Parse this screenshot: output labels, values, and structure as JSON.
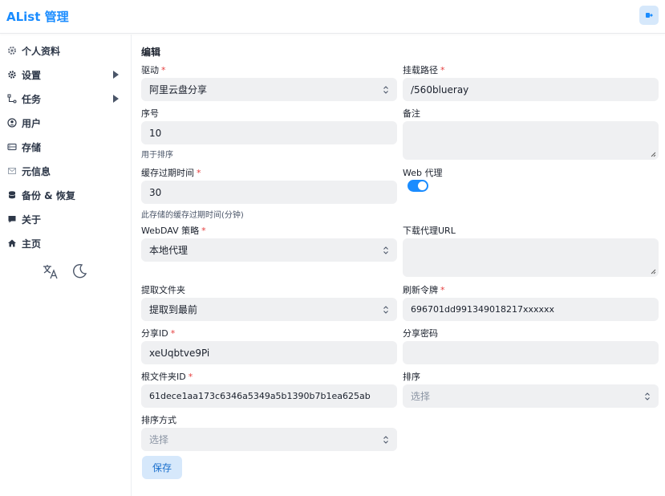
{
  "header": {
    "brand": "AList 管理"
  },
  "sidebar": {
    "items": [
      {
        "label": "个人资料",
        "icon": "gear-cog-icon"
      },
      {
        "label": "设置",
        "icon": "settings-icon",
        "expandable": true
      },
      {
        "label": "任务",
        "icon": "workflow-icon",
        "expandable": true
      },
      {
        "label": "用户",
        "icon": "user-circle-icon"
      },
      {
        "label": "存储",
        "icon": "storage-icon"
      },
      {
        "label": "元信息",
        "icon": "meta-icon"
      },
      {
        "label": "备份 & 恢复",
        "icon": "database-icon"
      },
      {
        "label": "关于",
        "icon": "about-icon"
      },
      {
        "label": "主页",
        "icon": "home-icon"
      }
    ]
  },
  "form": {
    "title": "编辑",
    "driver": {
      "label": "驱动",
      "value": "阿里云盘分享"
    },
    "mount_path": {
      "label": "挂载路径",
      "value": "/560blueray"
    },
    "order": {
      "label": "序号",
      "value": "10",
      "hint": "用于排序"
    },
    "remark": {
      "label": "备注",
      "value": ""
    },
    "cache_expiration": {
      "label": "缓存过期时间",
      "value": "30",
      "hint": "此存储的缓存过期时间(分钟)"
    },
    "web_proxy": {
      "label": "Web 代理",
      "enabled": true
    },
    "webdav_policy": {
      "label": "WebDAV 策略",
      "value": "本地代理"
    },
    "download_proxy_url": {
      "label": "下载代理URL",
      "value": ""
    },
    "extract_folder": {
      "label": "提取文件夹",
      "value": "提取到最前"
    },
    "refresh_token": {
      "label": "刷新令牌",
      "value": "696701dd991349018217xxxxxx"
    },
    "share_id": {
      "label": "分享ID",
      "value": "xeUqbtve9Pi"
    },
    "share_pwd": {
      "label": "分享密码",
      "value": ""
    },
    "root_folder_id": {
      "label": "根文件夹ID",
      "value": "61dece1aa173c6346a5349a5b1390b7b1ea625ab"
    },
    "order_by": {
      "label": "排序",
      "placeholder": "选择"
    },
    "order_direction": {
      "label": "排序方式",
      "placeholder": "选择"
    },
    "required_mark": "*",
    "save_label": "保存"
  },
  "colors": {
    "accent": "#1a8cff",
    "field_bg": "#eff0f2",
    "button_bg": "#d6e8fb",
    "required": "#e53e3e"
  }
}
